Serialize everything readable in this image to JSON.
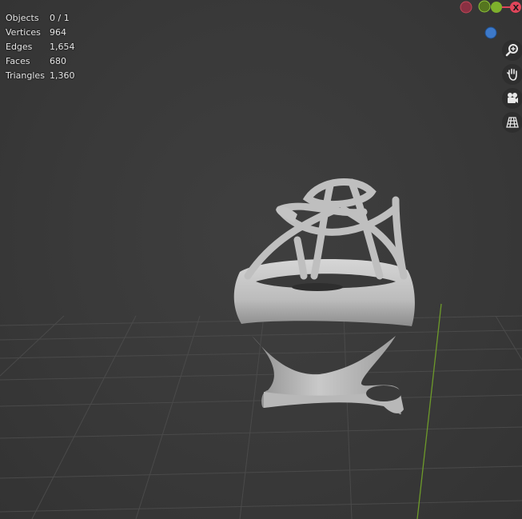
{
  "viewport": {
    "colors": {
      "background": "#3a3a3a",
      "grid": "#484848",
      "axis_y": "#6d9a2a",
      "axis_x": "#c8455a",
      "mesh": "#bdbdbd"
    }
  },
  "stats": [
    {
      "label": "Objects",
      "value": "0 / 1"
    },
    {
      "label": "Vertices",
      "value": "964"
    },
    {
      "label": "Edges",
      "value": "1,654"
    },
    {
      "label": "Faces",
      "value": "680"
    },
    {
      "label": "Triangles",
      "value": "1,360"
    }
  ],
  "gizmo": {
    "x_label": "X",
    "x_color": "#e0455a",
    "y_color": "#7eb02c",
    "z_color": "#3d79c9",
    "neg_x_color": "#8a3042",
    "neg_y_color": "#55751f"
  },
  "navigation": [
    {
      "icon": "zoom-icon"
    },
    {
      "icon": "hand-pan-icon"
    },
    {
      "icon": "camera-icon"
    },
    {
      "icon": "perspective-grid-icon"
    }
  ]
}
